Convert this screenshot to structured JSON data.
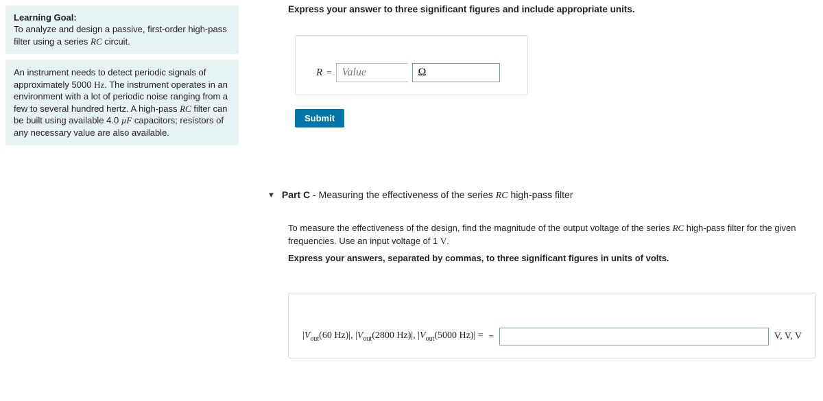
{
  "sidebar": {
    "learningGoal": {
      "title": "Learning Goal:",
      "text_pre": "To analyze and design a passive, first-order high-pass filter using a series ",
      "rc": "RC",
      "text_post": " circuit."
    },
    "problem": {
      "p1": "An instrument needs to detect periodic signals of approximately 5000 ",
      "hz1": "Hz",
      "p2": ". The instrument operates in an environment with a lot of periodic noise ranging from a few to several hundred hertz. A high-pass ",
      "rc": "RC",
      "p3": " filter can be built using available 4.0 ",
      "uf": "µF",
      "p4": " capacitors; resistors of any necessary value are also available."
    }
  },
  "main": {
    "instruction": "Express your answer to three significant figures and include appropriate units.",
    "answerB": {
      "var": "R",
      "eq": "=",
      "valuePlaceholder": "Value",
      "unitValue": "Ω"
    },
    "submit": "Submit",
    "partC": {
      "titleBold": "Part C",
      "titleSep": " - ",
      "titleRest1": "Measuring the effectiveness of the series ",
      "titleRC": "RC",
      "titleRest2": " high-pass filter",
      "body1a": "To measure the effectiveness of the design, find the magnitude of the output voltage of the series ",
      "bodyRC": "RC",
      "body1b": " high-pass filter for the given frequencies. Use an input voltage of 1 ",
      "bodyV": "V",
      "body1c": ".",
      "instruction": "Express your answers, separated by commas, to three significant figures in units of volts.",
      "vlabel": "|Vout(60 Hz)|, |Vout(2800 Hz)|, |Vout(5000 Hz)| =",
      "eq2": "=",
      "unitText": "V, V, V"
    }
  }
}
